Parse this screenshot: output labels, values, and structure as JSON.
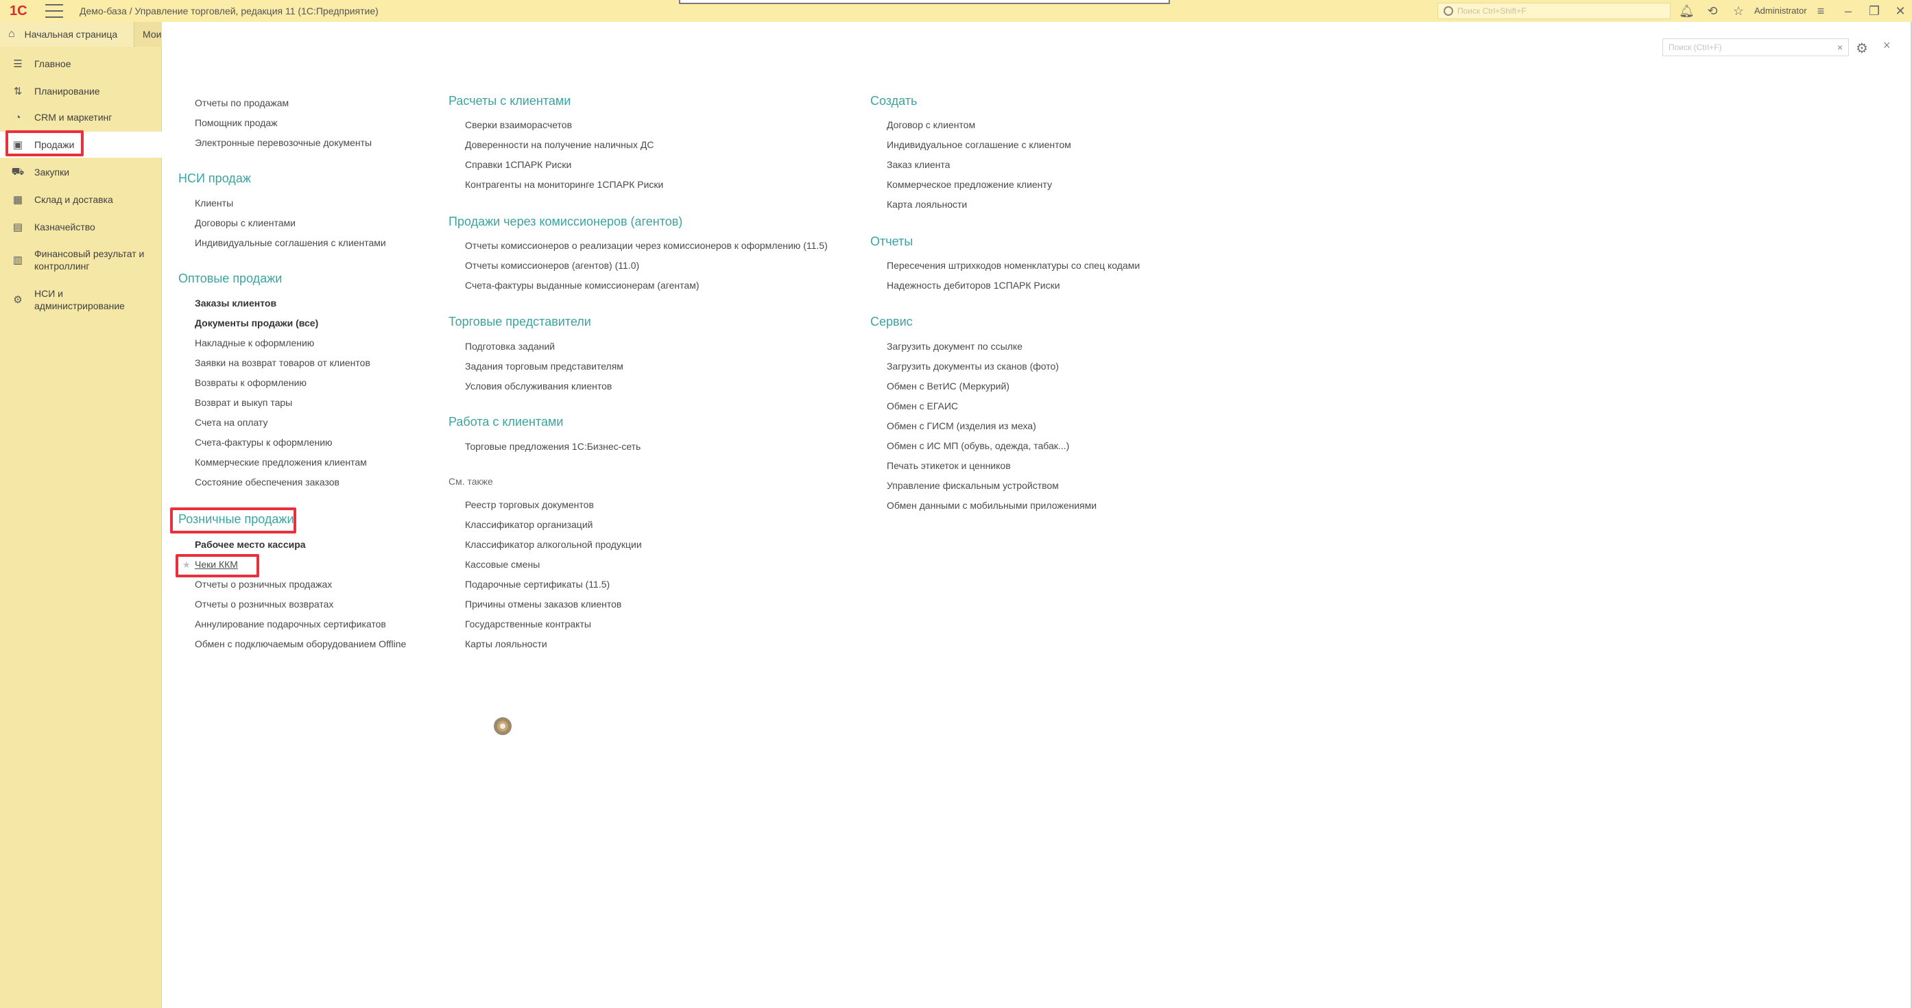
{
  "window": {
    "logo": "1С",
    "title": "Демо-база / Управление торговлей, редакция 11  (1С:Предприятие)",
    "search_placeholder": "Поиск Ctrl+Shift+F",
    "user": "Administrator"
  },
  "tabs": {
    "home": "Начальная страница",
    "second": "Мои"
  },
  "sidebar": {
    "items": [
      {
        "label": "Главное",
        "icon": "list-icon"
      },
      {
        "label": "Планирование",
        "icon": "planning-icon"
      },
      {
        "label": "CRM и маркетинг",
        "icon": "crm-icon"
      },
      {
        "label": "Продажи",
        "icon": "sales-bag-icon"
      },
      {
        "label": "Закупки",
        "icon": "cart-icon"
      },
      {
        "label": "Склад и доставка",
        "icon": "warehouse-icon"
      },
      {
        "label": "Казначейство",
        "icon": "treasury-icon"
      },
      {
        "label": "Финансовый результат и контроллинг",
        "icon": "chart-icon"
      },
      {
        "label": "НСИ и администрирование",
        "icon": "gear-icon"
      }
    ]
  },
  "panel": {
    "search_placeholder": "Поиск (Ctrl+F)"
  },
  "col1": {
    "top_links": [
      "Отчеты по продажам",
      "Помощник продаж",
      "Электронные перевозочные документы"
    ],
    "nsi_header": "НСИ продаж",
    "nsi_links": [
      "Клиенты",
      "Договоры с клиентами",
      "Индивидуальные соглашения с клиентами"
    ],
    "wholesale_header": "Оптовые продажи",
    "wholesale_links": [
      "Заказы клиентов",
      "Документы продажи (все)",
      "Накладные к оформлению",
      "Заявки на возврат товаров от клиентов",
      "Возвраты к оформлению",
      "Возврат и выкуп тары",
      "Счета на оплату",
      "Счета-фактуры к оформлению",
      "Коммерческие предложения клиентам",
      "Состояние обеспечения заказов"
    ],
    "retail_header": "Розничные продажи",
    "retail_links": [
      "Рабочее место кассира",
      "Чеки ККМ",
      "Отчеты о розничных продажах",
      "Отчеты о розничных возвратах",
      "Аннулирование подарочных сертификатов",
      "Обмен с подключаемым оборудованием Offline"
    ]
  },
  "col2": {
    "settlements_header": "Расчеты с клиентами",
    "settlements_links": [
      "Сверки взаиморасчетов",
      "Доверенности на получение наличных ДС",
      "Справки 1СПАРК Риски",
      "Контрагенты на мониторинге 1СПАРК Риски"
    ],
    "agents_header": "Продажи через комиссионеров (агентов)",
    "agents_links": [
      "Отчеты комиссионеров о реализации через комиссионеров к оформлению (11.5)",
      "Отчеты комиссионеров (агентов) (11.0)",
      "Счета-фактуры выданные комиссионерам (агентам)"
    ],
    "reps_header": "Торговые представители",
    "reps_links": [
      "Подготовка заданий",
      "Задания торговым представителям",
      "Условия обслуживания клиентов"
    ],
    "clients_header": "Работа с клиентами",
    "clients_links": [
      "Торговые предложения 1С:Бизнес-сеть"
    ],
    "see_also_header": "См. также",
    "see_also_links": [
      "Реестр торговых документов",
      "Классификатор организаций",
      "Классификатор алкогольной продукции",
      "Кассовые смены",
      "Подарочные сертификаты (11.5)",
      "Причины отмены заказов клиентов",
      "Государственные контракты",
      "Карты лояльности"
    ]
  },
  "col3": {
    "create_header": "Создать",
    "create_links": [
      "Договор с клиентом",
      "Индивидуальное соглашение с клиентом",
      "Заказ клиента",
      "Коммерческое предложение клиенту",
      "Карта лояльности"
    ],
    "reports_header": "Отчеты",
    "reports_links": [
      "Пересечения штрихкодов номенклатуры со спец кодами",
      "Надежность дебиторов 1СПАРК Риски"
    ],
    "service_header": "Сервис",
    "service_links": [
      "Загрузить документ по ссылке",
      "Загрузить документы из сканов (фото)",
      "Обмен с ВетИС (Меркурий)",
      "Обмен с ЕГАИС",
      "Обмен с ГИСМ (изделия из меха)",
      "Обмен с ИС МП (обувь, одежда, табак...)",
      "Печать этикеток и ценников",
      "Управление фискальным устройством",
      "Обмен данными с мобильными приложениями"
    ]
  },
  "colors": {
    "titlebar": "#fbeda8",
    "sidebar": "#f5e7a6",
    "section_header": "#3aa5a0",
    "highlight": "#e8313c"
  }
}
